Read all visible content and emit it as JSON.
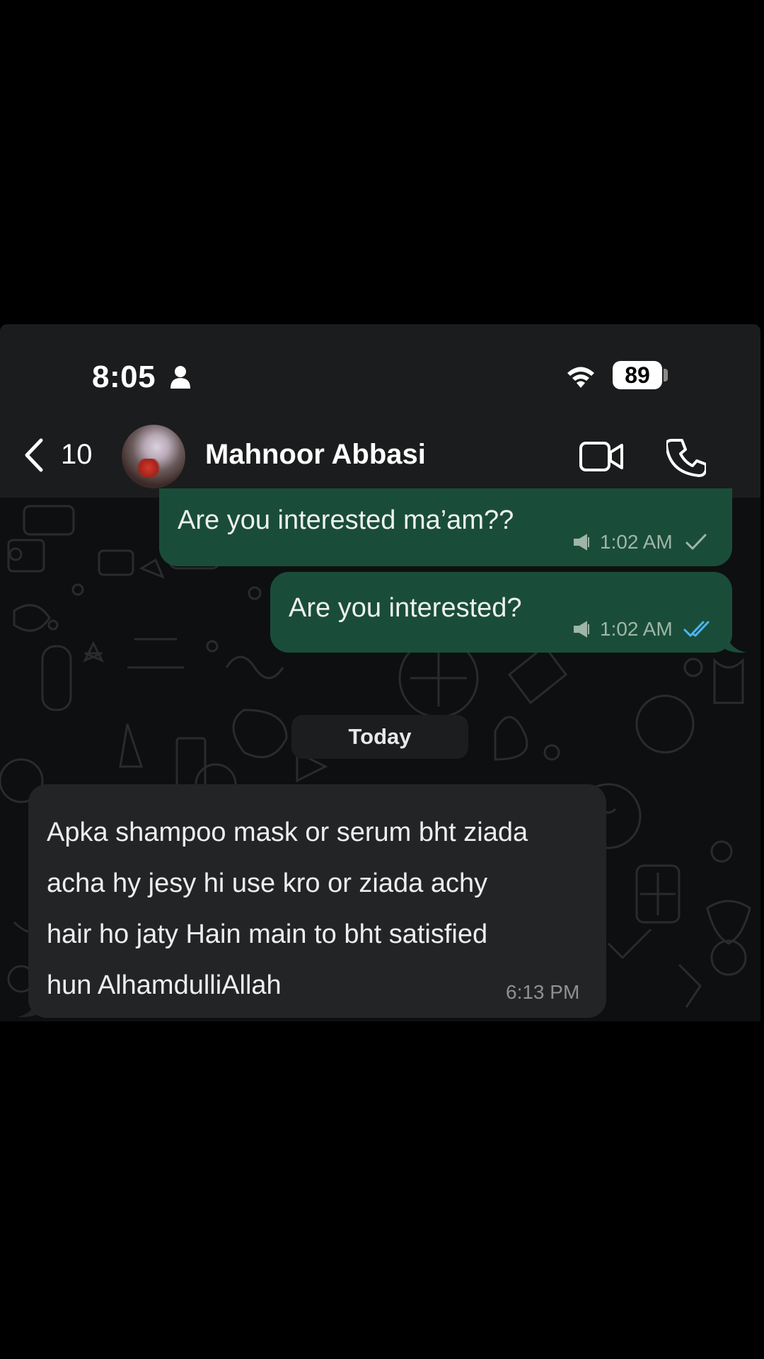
{
  "status_bar": {
    "time": "8:05",
    "battery": "89"
  },
  "header": {
    "back_count": "10",
    "contact_name": "Mahnoor Abbasi"
  },
  "messages": [
    {
      "direction": "outgoing",
      "text": "Are you interested ma’am??",
      "time": "1:02 AM",
      "status": "sent"
    },
    {
      "direction": "outgoing",
      "text": "Are you interested?",
      "time": "1:02 AM",
      "status": "read"
    }
  ],
  "date_divider": "Today",
  "incoming": {
    "lines": [
      "Apka shampoo mask or serum bht ziada",
      "acha hy jesy hi use kro or ziada achy",
      "hair ho jaty Hain main to bht satisfied",
      "hun AlhamdulliAllah"
    ],
    "time": "6:13 PM"
  },
  "colors": {
    "outgoing_bubble": "#1a4d39",
    "incoming_bubble": "#232426",
    "read_tick": "#4fb3f0"
  }
}
